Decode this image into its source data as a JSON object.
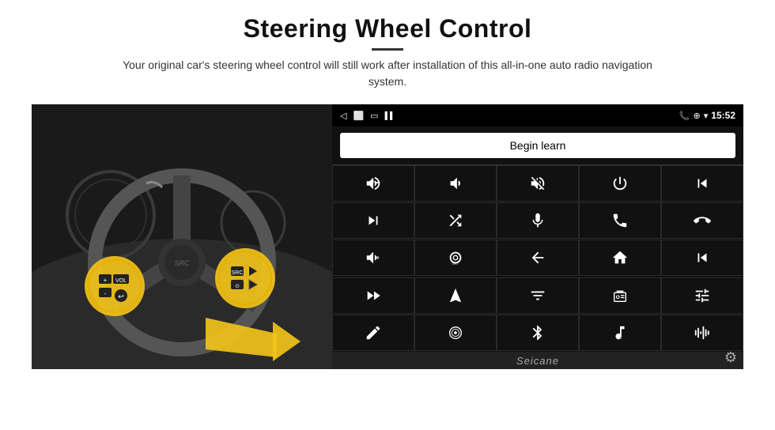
{
  "header": {
    "title": "Steering Wheel Control",
    "subtitle": "Your original car's steering wheel control will still work after installation of this all-in-one auto radio navigation system."
  },
  "status_bar": {
    "time": "15:52",
    "back_icon": "◁",
    "home_icon": "□",
    "recent_icon": "▭",
    "signal_icon": "▌▌",
    "phone_icon": "📞",
    "location_icon": "⊕",
    "wifi_icon": "▾"
  },
  "begin_learn": {
    "label": "Begin learn"
  },
  "icon_grid": [
    {
      "name": "vol-up",
      "symbol": "vol-up"
    },
    {
      "name": "vol-down",
      "symbol": "vol-down"
    },
    {
      "name": "mute",
      "symbol": "mute"
    },
    {
      "name": "power",
      "symbol": "power"
    },
    {
      "name": "prev-track",
      "symbol": "prev-track"
    },
    {
      "name": "next-track",
      "symbol": "next-track"
    },
    {
      "name": "shuffle",
      "symbol": "shuffle"
    },
    {
      "name": "mic",
      "symbol": "mic"
    },
    {
      "name": "phone",
      "symbol": "phone"
    },
    {
      "name": "hang-up",
      "symbol": "hang-up"
    },
    {
      "name": "horn",
      "symbol": "horn"
    },
    {
      "name": "camera-360",
      "symbol": "camera-360"
    },
    {
      "name": "back",
      "symbol": "back"
    },
    {
      "name": "home",
      "symbol": "home"
    },
    {
      "name": "skip-back",
      "symbol": "skip-back"
    },
    {
      "name": "fast-forward",
      "symbol": "fast-forward"
    },
    {
      "name": "navigation",
      "symbol": "navigation"
    },
    {
      "name": "equalizer",
      "symbol": "equalizer"
    },
    {
      "name": "radio",
      "symbol": "radio"
    },
    {
      "name": "settings-eq",
      "symbol": "settings-eq"
    },
    {
      "name": "pen",
      "symbol": "pen"
    },
    {
      "name": "screen",
      "symbol": "screen"
    },
    {
      "name": "bluetooth",
      "symbol": "bluetooth"
    },
    {
      "name": "music",
      "symbol": "music"
    },
    {
      "name": "waveform",
      "symbol": "waveform"
    }
  ],
  "seicane": {
    "brand": "Seicane"
  }
}
